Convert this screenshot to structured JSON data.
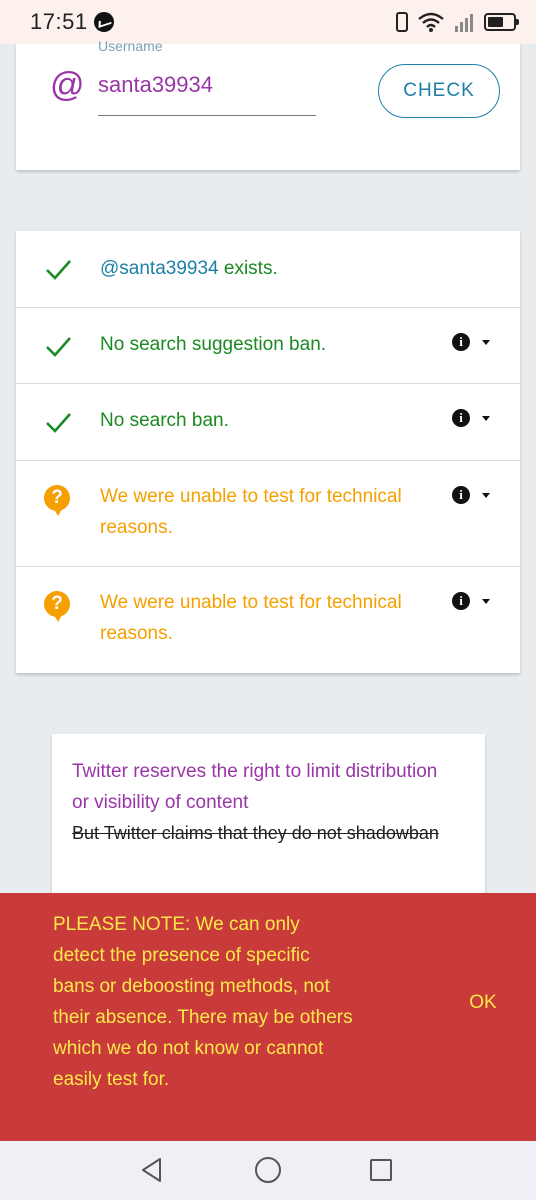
{
  "status_bar": {
    "time": "17:51",
    "icons": [
      "messenger-icon",
      "vibrate-icon",
      "wifi-icon",
      "signal-icon",
      "battery-icon"
    ]
  },
  "username_form": {
    "label": "Username",
    "at_symbol": "@",
    "value": "santa39934",
    "check_label": "CHECK"
  },
  "results": [
    {
      "status": "ok",
      "icon": "check-icon",
      "mention": "@santa39934",
      "text": " exists.",
      "has_info": false
    },
    {
      "status": "ok",
      "icon": "check-icon",
      "text": "No search suggestion ban.",
      "has_info": true
    },
    {
      "status": "ok",
      "icon": "check-icon",
      "text": "No search ban.",
      "has_info": true
    },
    {
      "status": "unknown",
      "icon": "question-icon",
      "text": "We were unable to test for technical reasons.",
      "has_info": true
    },
    {
      "status": "unknown",
      "icon": "question-icon",
      "text": "We were unable to test for technical reasons.",
      "has_info": true
    }
  ],
  "note": {
    "main": "Twitter reserves the right to limit distribution or visibility of content",
    "struck": "But Twitter claims that they do not shadowban"
  },
  "banner": {
    "text": "PLEASE NOTE: We can only detect the presence of specific bans or deboosting methods, not their absence. There may be others which we do not know or cannot easily test for.",
    "ok_label": "OK"
  },
  "colors": {
    "accent_purple": "#9a35a8",
    "link_blue": "#1e7fa8",
    "success_green": "#1a8a22",
    "warning_orange": "#f5a000",
    "banner_red": "#c93a3a",
    "banner_text_yellow": "#fbe94a"
  }
}
